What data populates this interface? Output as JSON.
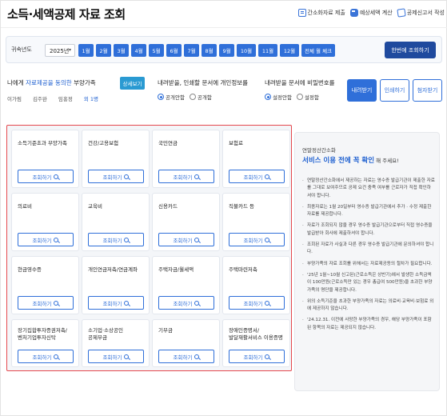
{
  "header": {
    "title": "소득·세액공제 자료 조회",
    "links": [
      {
        "label": "간소화자료 제출",
        "icon": "document-icon"
      },
      {
        "label": "예상세액 계산",
        "icon": "calculator-icon"
      },
      {
        "label": "공제신고서 작성",
        "icon": "form-icon"
      }
    ]
  },
  "year_bar": {
    "label": "귀속년도",
    "year_value": "2025년",
    "months": [
      "1월",
      "2월",
      "3월",
      "4월",
      "5월",
      "6월",
      "7월",
      "8월",
      "9월",
      "10월",
      "11월",
      "12월"
    ],
    "all_months": "전체 월 체크",
    "query_label": "한번에 조회하기"
  },
  "dependents": {
    "title_prefix": "나에게 ",
    "title_highlight": "자료제공을 동의한",
    "title_suffix": " 부양가족",
    "detail_label": "상세보기",
    "names": [
      "이가림",
      "김주완",
      "임홍정"
    ],
    "more": "외 1명"
  },
  "download_options": {
    "title": "내려받을, 인쇄할 문서에 개인정보를",
    "options": [
      {
        "label": "공개안함",
        "selected": true
      },
      {
        "label": "공개함",
        "selected": false
      }
    ]
  },
  "password_options": {
    "title": "내려받을 문서에 비밀번호를",
    "options": [
      {
        "label": "설정안함",
        "selected": true
      },
      {
        "label": "설정함",
        "selected": false
      }
    ]
  },
  "actions": {
    "download": "내려받기",
    "print": "인쇄하기",
    "email": "첨자받기"
  },
  "grid": {
    "query_label": "조회하기",
    "items": [
      {
        "title": "소득기준초과 부양가족"
      },
      {
        "title": "건강/고용보험"
      },
      {
        "title": "국민연금"
      },
      {
        "title": "보험료"
      },
      {
        "title": "의료비"
      },
      {
        "title": "교육비"
      },
      {
        "title": "신용카드"
      },
      {
        "title": "직불카드 등"
      },
      {
        "title": "현금영수증"
      },
      {
        "title": "개인연금저축/연금계좌"
      },
      {
        "title": "주택자금/월세액"
      },
      {
        "title": "주택마련저축"
      },
      {
        "title": "장기집합투자증권저축/\n벤처기업투자신탁"
      },
      {
        "title": "소기업·소상공인\n공제부금"
      },
      {
        "title": "기부금"
      },
      {
        "title": "장애인증명서/\n발달재활서비스 이용증명"
      }
    ]
  },
  "notice": {
    "sub": "연말정산간소화",
    "title_blue": "서비스 이용 전에 꼭 확인",
    "title_suffix": " 해 주세요!",
    "bullets": [
      "연말정산간소화에서 제공하는 자료는 영수증 발급기관이 제출한 자료를 그대로 보여주므로 공제 요건 충족 여부를 근로자가 직접 확인하셔야 합니다.",
      "최종자료는 1월 20일부터 영수증 발급기관에서 추가 · 수정 제출한 자료를 제공합니다.",
      "자료가 조회되지 않을 경우 영수증 발급기관으로부터 직접 영수증을 발급받아 회사에 제출하셔야 합니다.",
      "조회된 자료가 사실과 다른 경우 영수증 발급기관에 문의하셔야 합니다.",
      "부양가족의 자료 조회를 위해서는 자료제공동의 절차가 필요합니다.",
      "'25년 1월~10월 신고된(근로소득은 상반기)에서 발생한 소득금액이 100만원(근로소득만 있는 경우 총급여 500만원)을 초과한 부양가족의 명단을 제공합니다.",
      "위의 소득기준을 초과한 부양가족의 자료는 의료비·교육비·보험료 외에 제공하지 않습니다.",
      "'24.12.31. 이전에 사망한 부양가족의 경우, 해당 부양가족이 포함된 항목의 자료는 제공되지 않습니다."
    ]
  }
}
